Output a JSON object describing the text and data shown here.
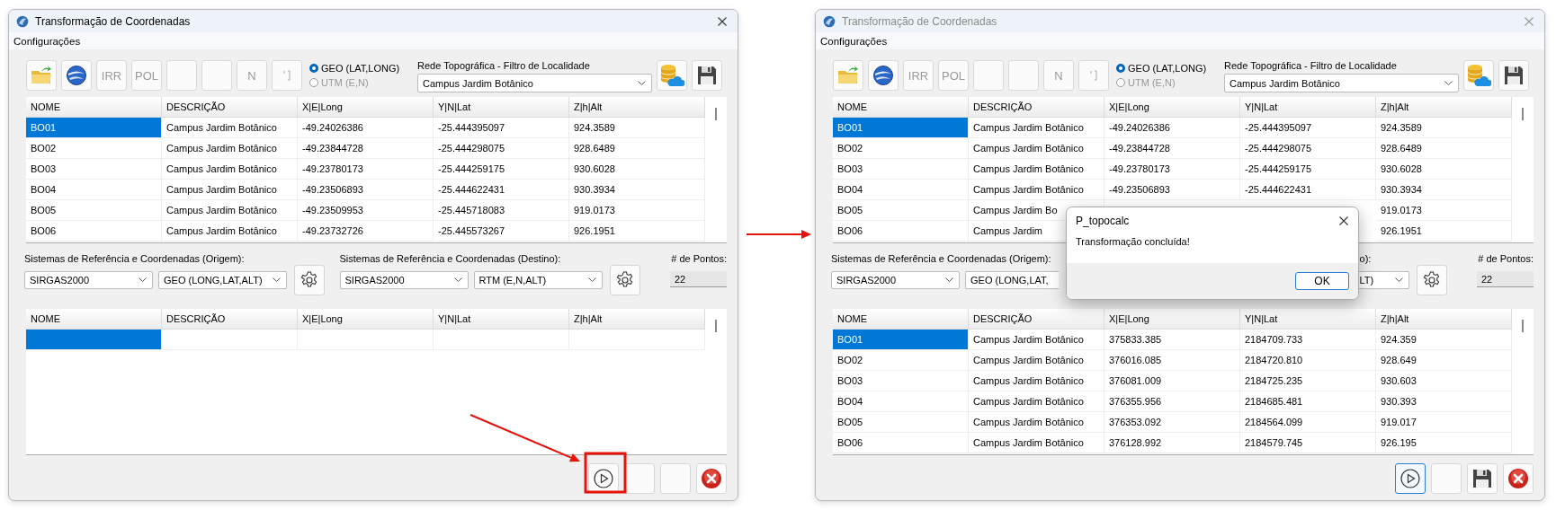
{
  "windows": [
    {
      "title": "Transformação de Coordenadas",
      "active": true,
      "menu": [
        "Configurações"
      ],
      "toolbar": [
        {
          "kind": "folder"
        },
        {
          "kind": "globe"
        },
        {
          "kind": "text",
          "label": "IRR",
          "disabled": true
        },
        {
          "kind": "text",
          "label": "POL",
          "disabled": true
        },
        {
          "kind": "blank"
        },
        {
          "kind": "blank"
        },
        {
          "kind": "text",
          "label": "N",
          "disabled": true
        },
        {
          "kind": "bracket"
        }
      ],
      "radios": [
        {
          "label": "GEO (LAT,LONG)",
          "selected": true,
          "disabled": false
        },
        {
          "label": "UTM (E,N)",
          "selected": false,
          "disabled": true
        }
      ],
      "filter": {
        "label": "Rede Topográfica - Filtro de Localidade",
        "value": "Campus Jardim Botânico"
      },
      "side_buttons": [
        {
          "kind": "database"
        },
        {
          "kind": "save"
        }
      ],
      "table": {
        "columns": [
          "NOME",
          "DESCRIÇÃO",
          "X|E|Long",
          "Y|N|Lat",
          "Z|h|Alt"
        ],
        "rows": [
          {
            "cells": [
              "BO01",
              "Campus Jardim Botânico",
              "-49.24026386",
              "-25.444395097",
              "924.3589"
            ],
            "selected": true
          },
          {
            "cells": [
              "BO02",
              "Campus Jardim Botânico",
              "-49.23844728",
              "-25.444298075",
              "928.6489"
            ],
            "selected": false
          },
          {
            "cells": [
              "BO03",
              "Campus Jardim Botânico",
              "-49.23780173",
              "-25.444259175",
              "930.6028"
            ],
            "selected": false
          },
          {
            "cells": [
              "BO04",
              "Campus Jardim Botânico",
              "-49.23506893",
              "-25.444622431",
              "930.3934"
            ],
            "selected": false
          },
          {
            "cells": [
              "BO05",
              "Campus Jardim Botânico",
              "-49.23509953",
              "-25.445718083",
              "919.0173"
            ],
            "selected": false
          },
          {
            "cells": [
              "BO06",
              "Campus Jardim Botânico",
              "-49.23732726",
              "-25.445573267",
              "926.1951"
            ],
            "selected": false
          }
        ]
      },
      "origin": {
        "label": "Sistemas de Referência e Coordenadas (Origem):",
        "datum": "SIRGAS2000",
        "system": "GEO (LONG,LAT,ALT)",
        "settings_button": true
      },
      "destination": {
        "label": "Sistemas de Referência e Coordenadas (Destino):",
        "datum": "SIRGAS2000",
        "system": "RTM (E,N,ALT)",
        "settings_button": true
      },
      "points": {
        "label": "# de Pontos:",
        "value": "22"
      },
      "result_table": {
        "columns": [
          "NOME",
          "DESCRIÇÃO",
          "X|E|Long",
          "Y|N|Lat",
          "Z|h|Alt"
        ],
        "rows": [
          {
            "selected": true
          }
        ]
      },
      "bottom_buttons": [
        {
          "kind": "run",
          "focused": false
        },
        {
          "kind": "blank"
        },
        {
          "kind": "blank"
        },
        {
          "kind": "cancel"
        }
      ]
    },
    {
      "title": "Transformação de Coordenadas",
      "active": false,
      "menu": [
        "Configurações"
      ],
      "toolbar": [
        {
          "kind": "folder"
        },
        {
          "kind": "globe"
        },
        {
          "kind": "text",
          "label": "IRR",
          "disabled": true
        },
        {
          "kind": "text",
          "label": "POL",
          "disabled": true
        },
        {
          "kind": "blank"
        },
        {
          "kind": "blank"
        },
        {
          "kind": "text",
          "label": "N",
          "disabled": true
        },
        {
          "kind": "bracket"
        }
      ],
      "radios": [
        {
          "label": "GEO (LAT,LONG)",
          "selected": true,
          "disabled": false
        },
        {
          "label": "UTM (E,N)",
          "selected": false,
          "disabled": true
        }
      ],
      "filter": {
        "label": "Rede Topográfica - Filtro de Localidade",
        "value": "Campus Jardim Botânico"
      },
      "side_buttons": [
        {
          "kind": "database"
        },
        {
          "kind": "save"
        }
      ],
      "table": {
        "columns": [
          "NOME",
          "DESCRIÇÃO",
          "X|E|Long",
          "Y|N|Lat",
          "Z|h|Alt"
        ],
        "rows": [
          {
            "cells": [
              "BO01",
              "Campus Jardim Botânico",
              "-49.24026386",
              "-25.444395097",
              "924.3589"
            ],
            "selected": true
          },
          {
            "cells": [
              "BO02",
              "Campus Jardim Botânico",
              "-49.23844728",
              "-25.444298075",
              "928.6489"
            ],
            "selected": false
          },
          {
            "cells": [
              "BO03",
              "Campus Jardim Botânico",
              "-49.23780173",
              "-25.444259175",
              "930.6028"
            ],
            "selected": false
          },
          {
            "cells": [
              "BO04",
              "Campus Jardim Botânico",
              "-49.23506893",
              "-25.444622431",
              "930.3934"
            ],
            "selected": false
          },
          {
            "cells": [
              "BO05",
              "Campus Jardim Bo",
              null,
              null,
              "919.0173"
            ],
            "selected": false
          },
          {
            "cells": [
              "BO06",
              "Campus Jardim",
              null,
              null,
              "926.1951"
            ],
            "selected": false
          }
        ]
      },
      "origin": {
        "label": "Sistemas de Referência e Coordenadas (Origem):",
        "datum": "SIRGAS2000",
        "system": "GEO (LONG,LAT,",
        "system_cut_end": true,
        "settings_button": false
      },
      "destination": {
        "label": "o):",
        "label_cut_start": true,
        "system": "LT)",
        "system_cut_start": true,
        "settings_button": true
      },
      "points": {
        "label": "# de Pontos:",
        "value": "22"
      },
      "result_table": {
        "columns": [
          "NOME",
          "DESCRIÇÃO",
          "X|E|Long",
          "Y|N|Lat",
          "Z|h|Alt"
        ],
        "rows": [
          {
            "cells": [
              "BO01",
              "Campus Jardim Botânico",
              "375833.385",
              "2184709.733",
              "924.359"
            ],
            "selected": true
          },
          {
            "cells": [
              "BO02",
              "Campus Jardim Botânico",
              "376016.085",
              "2184720.810",
              "928.649"
            ],
            "selected": false
          },
          {
            "cells": [
              "BO03",
              "Campus Jardim Botânico",
              "376081.009",
              "2184725.235",
              "930.603"
            ],
            "selected": false
          },
          {
            "cells": [
              "BO04",
              "Campus Jardim Botânico",
              "376355.956",
              "2184685.481",
              "930.393"
            ],
            "selected": false
          },
          {
            "cells": [
              "BO05",
              "Campus Jardim Botânico",
              "376353.092",
              "2184564.099",
              "919.017"
            ],
            "selected": false
          },
          {
            "cells": [
              "BO06",
              "Campus Jardim Botânico",
              "376128.992",
              "2184579.745",
              "926.195"
            ],
            "selected": false
          }
        ]
      },
      "bottom_buttons": [
        {
          "kind": "run",
          "focused": true
        },
        {
          "kind": "blank"
        },
        {
          "kind": "save"
        },
        {
          "kind": "cancel"
        }
      ],
      "dialog": {
        "title": "P_topocalc",
        "message": "Transformação concluída!",
        "button": "OK"
      }
    }
  ],
  "annotations": [
    {
      "kind": "arrow"
    },
    {
      "kind": "frame"
    },
    {
      "kind": "arrow"
    }
  ]
}
